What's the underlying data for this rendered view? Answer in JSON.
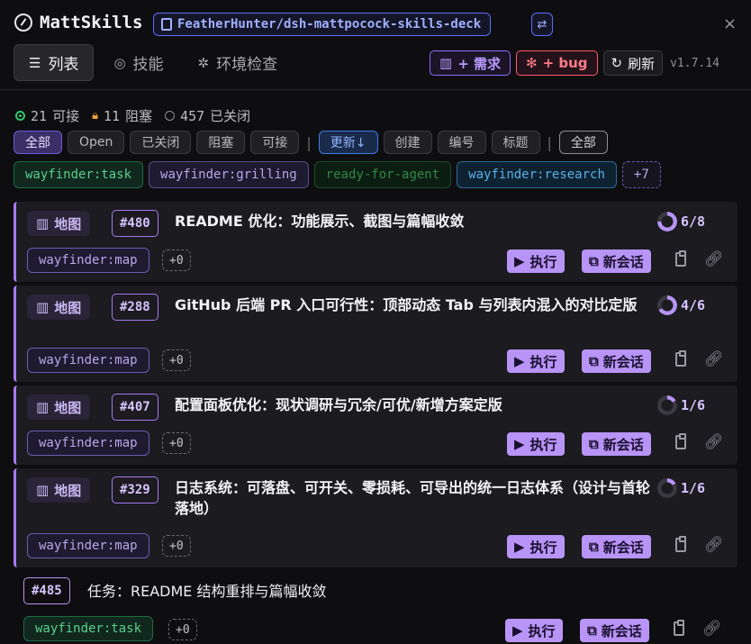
{
  "header": {
    "app_title": "MattSkills",
    "repo": "FeatherHunter/dsh-mattpocock-skills-deck",
    "swap_icon": "⇄",
    "close_icon": "×"
  },
  "nav": {
    "tabs": [
      {
        "label": "列表",
        "icon": "list-icon",
        "glyph": "☰"
      },
      {
        "label": "技能",
        "icon": "compass-icon",
        "glyph": "◎"
      },
      {
        "label": "环境检查",
        "icon": "gear-icon",
        "glyph": "✲"
      }
    ]
  },
  "actions": {
    "request": "+ 需求",
    "bug": "+ bug",
    "refresh": "刷新",
    "version": "v1.7.14"
  },
  "stats": {
    "open_count": "21",
    "open_label": "可接",
    "blocked_count": "11",
    "blocked_label": "阻塞",
    "closed_count": "457",
    "closed_label": "已关闭"
  },
  "filters": {
    "state": [
      "全部",
      "Open",
      "已关闭",
      "阻塞",
      "可接"
    ],
    "sort": [
      "更新↓",
      "创建",
      "编号",
      "标题"
    ],
    "scope": "全部"
  },
  "labels": [
    "wayfinder:task",
    "wayfinder:grilling",
    "ready-for-agent",
    "wayfinder:research",
    "+7"
  ],
  "cards": [
    {
      "chip": "地图",
      "number": "#480",
      "title": "README 优化：功能展示、截图与篇幅收敛",
      "progress": "6/8",
      "progress_value": 0.75,
      "label": "wayfinder:map",
      "extra": "+0",
      "run": "执行",
      "session": "新会话"
    },
    {
      "chip": "地图",
      "number": "#288",
      "title": "GitHub 后端 PR 入口可行性：顶部动态 Tab 与列表内混入的对比定版",
      "progress": "4/6",
      "progress_value": 0.6667,
      "label": "wayfinder:map",
      "extra": "+0",
      "run": "执行",
      "session": "新会话"
    },
    {
      "chip": "地图",
      "number": "#407",
      "title": "配置面板优化：现状调研与冗余/可优/新增方案定版",
      "progress": "1/6",
      "progress_value": 0.1667,
      "label": "wayfinder:map",
      "extra": "+0",
      "run": "执行",
      "session": "新会话"
    },
    {
      "chip": "地图",
      "number": "#329",
      "title": "日志系统：可落盘、可开关、零损耗、可导出的统一日志体系（设计与首轮落地）",
      "progress": "1/6",
      "progress_value": 0.1667,
      "label": "wayfinder:map",
      "extra": "+0",
      "run": "执行",
      "session": "新会话"
    }
  ],
  "plain_item": {
    "number": "#485",
    "title": "任务：README 结构重排与篇幅收敛",
    "label": "wayfinder:task",
    "extra": "+0",
    "run": "执行",
    "session": "新会话"
  },
  "colors": {
    "accent": "#a779f0",
    "button": "#b894f6",
    "open": "#32c86a",
    "blocked": "#f0a040",
    "bug": "#ff5a6a"
  }
}
